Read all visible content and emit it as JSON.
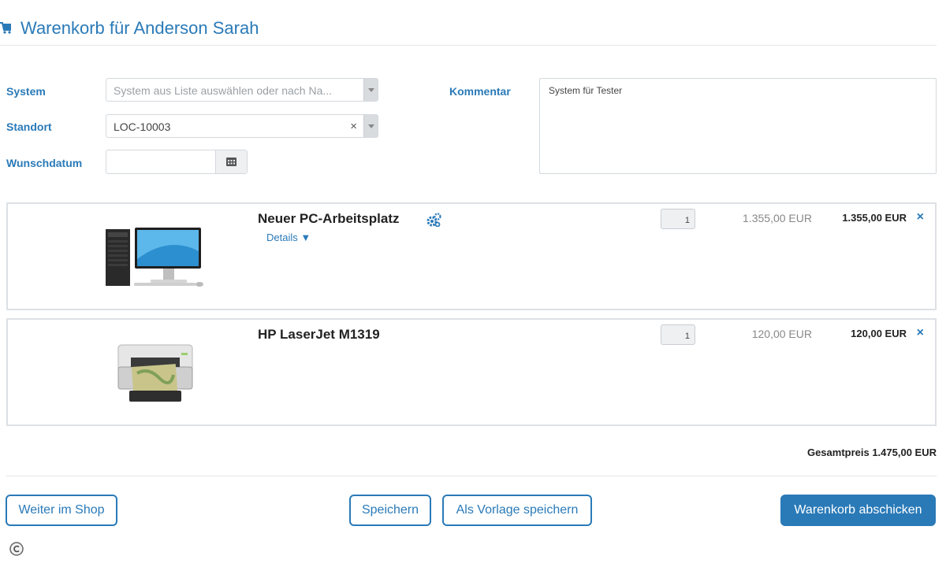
{
  "header": {
    "title": "Warenkorb für Anderson Sarah",
    "icon": "cart-icon"
  },
  "form": {
    "system_label": "System",
    "system_placeholder": "System aus Liste auswählen oder nach Na...",
    "standort_label": "Standort",
    "standort_value": "LOC-10003",
    "wunschdatum_label": "Wunschdatum",
    "wunschdatum_value": "",
    "kommentar_label": "Kommentar",
    "kommentar_value": "System für Tester"
  },
  "items": [
    {
      "name": "Neuer PC-Arbeitsplatz",
      "details": "Details ▼",
      "quantity": "1",
      "unit_price": "1.355,00 EUR",
      "total_price": "1.355,00 EUR",
      "remove": "×"
    },
    {
      "name": "HP LaserJet M1319",
      "quantity": "1",
      "unit_price": "120,00 EUR",
      "total_price": "120,00 EUR",
      "remove": "×"
    }
  ],
  "summary": {
    "total": "Gesamtpreis 1.475,00 EUR"
  },
  "buttons": {
    "continue": "Weiter im Shop",
    "save": "Speichern",
    "save_template": "Als Vorlage speichern",
    "submit": "Warenkorb abschicken"
  },
  "colors": {
    "accent": "#2a7ab8",
    "border": "#dde1e5"
  }
}
